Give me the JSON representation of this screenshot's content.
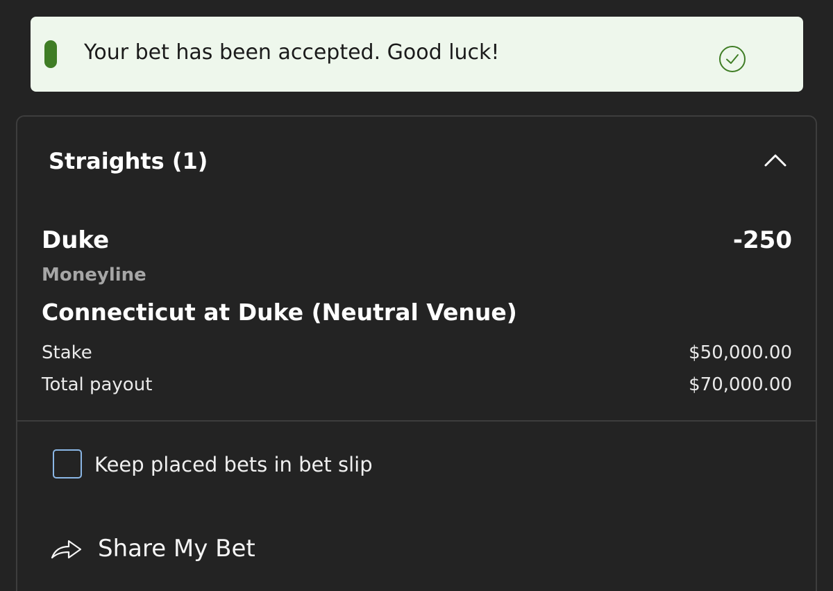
{
  "toast": {
    "message": "Your bet has been accepted. Good luck!",
    "icon": "check-circle-icon",
    "accent_color": "#3f7d25",
    "background_color": "#eef7ec"
  },
  "bet_slip": {
    "section_title": "Straights (1)",
    "collapse_icon": "chevron-up-icon",
    "bet": {
      "selection": "Duke",
      "odds": "-250",
      "market": "Moneyline",
      "event": "Connecticut at Duke (Neutral Venue)",
      "stake_label": "Stake",
      "stake_value": "$50,000.00",
      "payout_label": "Total payout",
      "payout_value": "$70,000.00"
    },
    "keep_bets": {
      "label": "Keep placed bets in bet slip",
      "checked": false
    },
    "share": {
      "label": "Share My Bet",
      "icon": "share-arrow-icon"
    }
  }
}
